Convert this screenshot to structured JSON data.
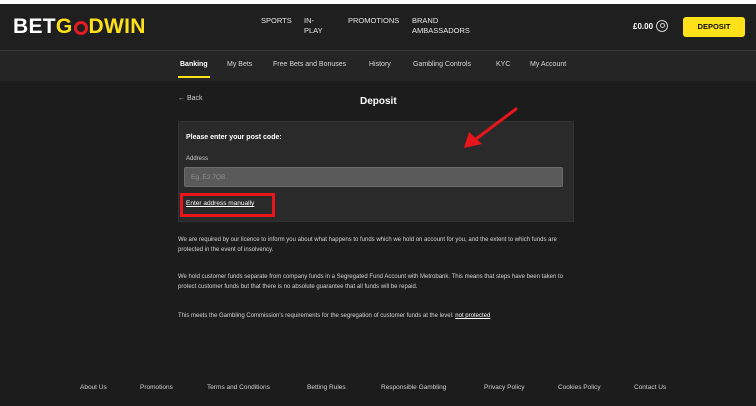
{
  "header": {
    "logo_part1": "BET",
    "logo_part2": "G",
    "logo_part3": "DWIN",
    "nav": [
      "SPORTS",
      "IN-PLAY",
      "PROMOTIONS",
      "BRAND AMBASSADORS"
    ],
    "balance": "£0.00",
    "deposit_label": "DEPOSIT"
  },
  "subnav": {
    "items": [
      "Banking",
      "My Bets",
      "Free Bets and Bonuses",
      "History",
      "Gambling Controls",
      "KYC",
      "My Account"
    ],
    "active": "Banking"
  },
  "page": {
    "back_label": "Back",
    "title": "Deposit"
  },
  "form": {
    "prompt": "Please enter your post code:",
    "address_label": "Address",
    "address_placeholder": "Eg. E2 7QB",
    "manual_link": "Enter address manually"
  },
  "info": {
    "para1": "We are required by our licence to inform you about what happens to funds which we hold on account for you, and the extent to which funds are protected in the event of insolvency.",
    "para2": "We hold customer funds separate from company funds in a Segregated Fund Account with Metrobank. This means that steps have been taken to protect customer funds but that there is no absolute guarantee that all funds will be repaid.",
    "para3_text": "This meets the Gambling Commission's requirements for the segregation of customer funds at the level:",
    "para3_level": "not protected"
  },
  "footer": {
    "links": [
      "About Us",
      "Promotions",
      "Terms and Conditions",
      "Betting Rules",
      "Responsible Gambling",
      "Privacy Policy",
      "Cookies Policy",
      "Contact Us"
    ]
  },
  "colors": {
    "accent": "#ffe11a",
    "highlight": "#e8151b",
    "background": "#1c1c1c"
  }
}
